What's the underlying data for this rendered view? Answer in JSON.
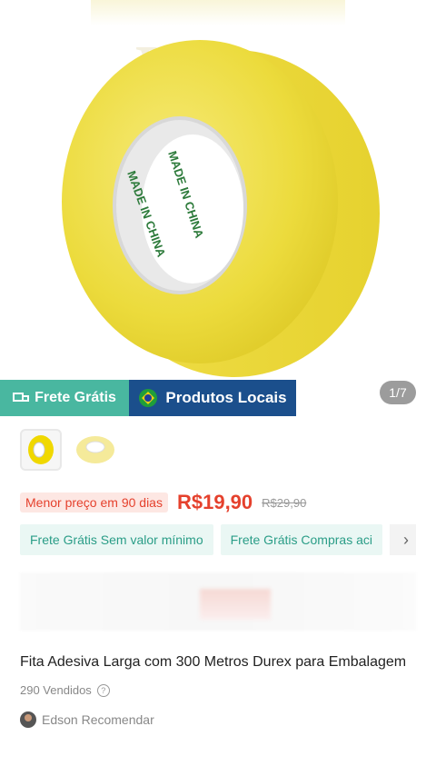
{
  "image_counter": "1/7",
  "tape_print": "MADE IN CHINA",
  "badges": {
    "free_shipping": "Frete Grátis",
    "local_products": "Produtos Locais"
  },
  "price": {
    "lowest_label": "Menor preço em 90 dias",
    "current": "R$19,90",
    "original": "R$29,90"
  },
  "promos": [
    "Frete Grátis Sem valor mínimo",
    "Frete Grátis Compras aci"
  ],
  "product": {
    "title": "Fita Adesiva Larga com 300 Metros Durex para Embalagem",
    "sold": "290 Vendidos",
    "recommender": "Edson Recomendar"
  },
  "colors": {
    "accent_red": "#e5412d",
    "teal": "#49b7a0",
    "navy": "#1b4f8c",
    "tape_yellow": "#f3e24a"
  }
}
